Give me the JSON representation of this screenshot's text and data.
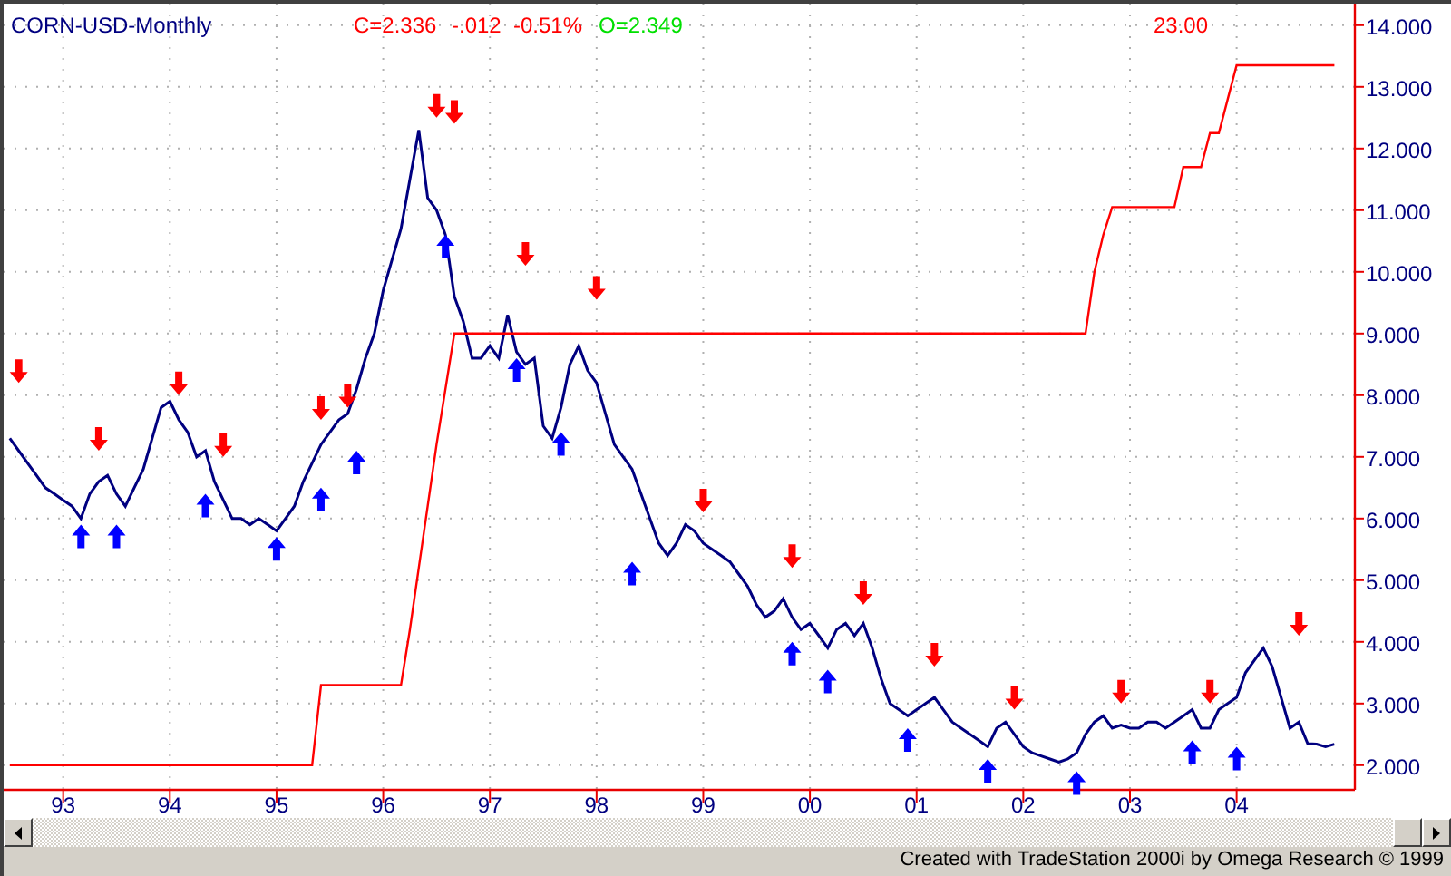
{
  "chart": {
    "title": "CORN-USD-Monthly",
    "quote": {
      "close": "C=2.336",
      "change": "-.012",
      "percent": "-0.51%",
      "open": "O=2.349"
    },
    "indicator_value": "23.00",
    "chart_data": {
      "type": "line",
      "categories": [
        null,
        null,
        null,
        null,
        null,
        null,
        "93",
        null,
        null,
        null,
        null,
        null,
        null,
        null,
        null,
        null,
        null,
        null,
        "94",
        null,
        null,
        null,
        null,
        null,
        null,
        null,
        null,
        null,
        null,
        null,
        "95",
        null,
        null,
        null,
        null,
        null,
        null,
        null,
        null,
        null,
        null,
        null,
        "96",
        null,
        null,
        null,
        null,
        null,
        null,
        null,
        null,
        null,
        null,
        null,
        "97",
        null,
        null,
        null,
        null,
        null,
        null,
        null,
        null,
        null,
        null,
        null,
        "98",
        null,
        null,
        null,
        null,
        null,
        null,
        null,
        null,
        null,
        null,
        null,
        "99",
        null,
        null,
        null,
        null,
        null,
        null,
        null,
        null,
        null,
        null,
        null,
        "00",
        null,
        null,
        null,
        null,
        null,
        null,
        null,
        null,
        null,
        null,
        null,
        "01",
        null,
        null,
        null,
        null,
        null,
        null,
        null,
        null,
        null,
        null,
        null,
        "02",
        null,
        null,
        null,
        null,
        null,
        null,
        null,
        null,
        null,
        null,
        null,
        "03",
        null,
        null,
        null,
        null,
        null,
        null,
        null,
        null,
        null,
        null,
        null,
        "04",
        null,
        null,
        null,
        null,
        null,
        null,
        null,
        null,
        null,
        null,
        null
      ],
      "series": [
        {
          "color": "#000080",
          "values": [
            7.3,
            7.1,
            6.9,
            6.7,
            6.5,
            6.4,
            6.3,
            6.2,
            6.0,
            6.4,
            6.6,
            6.7,
            6.4,
            6.2,
            6.5,
            6.8,
            7.3,
            7.8,
            7.9,
            7.6,
            7.4,
            7.0,
            7.1,
            6.6,
            6.3,
            6.0,
            6.0,
            5.9,
            6.0,
            5.9,
            5.8,
            6.0,
            6.2,
            6.6,
            6.9,
            7.2,
            7.4,
            7.6,
            7.7,
            8.1,
            8.6,
            9.0,
            9.7,
            10.2,
            10.7,
            11.5,
            12.3,
            11.2,
            11.0,
            10.6,
            9.6,
            9.2,
            8.6,
            8.6,
            8.8,
            8.6,
            9.3,
            8.7,
            8.5,
            8.6,
            7.5,
            7.3,
            7.8,
            8.5,
            8.8,
            8.4,
            8.2,
            7.7,
            7.2,
            7.0,
            6.8,
            6.4,
            6.0,
            5.6,
            5.4,
            5.6,
            5.9,
            5.8,
            5.6,
            5.5,
            5.4,
            5.3,
            5.1,
            4.9,
            4.6,
            4.4,
            4.5,
            4.7,
            4.4,
            4.2,
            4.3,
            4.1,
            3.9,
            4.2,
            4.3,
            4.1,
            4.3,
            3.9,
            3.4,
            3.0,
            2.9,
            2.8,
            2.9,
            3.0,
            3.1,
            2.9,
            2.7,
            2.6,
            2.5,
            2.4,
            2.3,
            2.6,
            2.7,
            2.5,
            2.3,
            2.2,
            2.15,
            2.1,
            2.05,
            2.1,
            2.2,
            2.5,
            2.7,
            2.8,
            2.6,
            2.65,
            2.6,
            2.6,
            2.7,
            2.7,
            2.6,
            2.7,
            2.8,
            2.9,
            2.6,
            2.6,
            2.9,
            3.0,
            3.1,
            3.5,
            3.7,
            3.9,
            3.6,
            3.1,
            2.6,
            2.7,
            2.35,
            2.34,
            2.3,
            2.34
          ]
        },
        {
          "color": "#ff0000",
          "values": [
            2.0,
            2.0,
            2.0,
            2.0,
            2.0,
            2.0,
            2.0,
            2.0,
            2.0,
            2.0,
            2.0,
            2.0,
            2.0,
            2.0,
            2.0,
            2.0,
            2.0,
            2.0,
            2.0,
            2.0,
            2.0,
            2.0,
            2.0,
            2.0,
            2.0,
            2.0,
            2.0,
            2.0,
            2.0,
            2.0,
            2.0,
            2.0,
            2.0,
            2.0,
            2.0,
            3.3,
            3.3,
            3.3,
            3.3,
            3.3,
            3.3,
            3.3,
            3.3,
            3.3,
            3.3,
            4.2,
            5.2,
            6.2,
            7.2,
            8.1,
            9.0,
            9.0,
            9.0,
            9.0,
            9.0,
            9.0,
            9.0,
            9.0,
            9.0,
            9.0,
            9.0,
            9.0,
            9.0,
            9.0,
            9.0,
            9.0,
            9.0,
            9.0,
            9.0,
            9.0,
            9.0,
            9.0,
            9.0,
            9.0,
            9.0,
            9.0,
            9.0,
            9.0,
            9.0,
            9.0,
            9.0,
            9.0,
            9.0,
            9.0,
            9.0,
            9.0,
            9.0,
            9.0,
            9.0,
            9.0,
            9.0,
            9.0,
            9.0,
            9.0,
            9.0,
            9.0,
            9.0,
            9.0,
            9.0,
            9.0,
            9.0,
            9.0,
            9.0,
            9.0,
            9.0,
            9.0,
            9.0,
            9.0,
            9.0,
            9.0,
            9.0,
            9.0,
            9.0,
            9.0,
            9.0,
            9.0,
            9.0,
            9.0,
            9.0,
            9.0,
            9.0,
            9.0,
            10.0,
            10.6,
            11.05,
            11.05,
            11.05,
            11.05,
            11.05,
            11.05,
            11.05,
            11.05,
            11.7,
            11.7,
            11.7,
            12.25,
            12.25,
            12.8,
            13.35,
            13.35,
            13.35,
            13.35,
            13.35,
            13.35,
            13.35,
            13.35,
            13.35,
            13.35,
            13.35,
            13.35
          ]
        }
      ],
      "ylim": [
        1.6,
        14.35
      ],
      "yticks": [
        {
          "value": 2,
          "label": "2.000"
        },
        {
          "value": 3,
          "label": "3.000"
        },
        {
          "value": 4,
          "label": "4.000"
        },
        {
          "value": 5,
          "label": "5.000"
        },
        {
          "value": 6,
          "label": "6.000"
        },
        {
          "value": 7,
          "label": "7.000"
        },
        {
          "value": 8,
          "label": "8.000"
        },
        {
          "value": 9,
          "label": "9.000"
        },
        {
          "value": 10,
          "label": "10.000"
        },
        {
          "value": 11,
          "label": "11.000"
        },
        {
          "value": 12,
          "label": "12.000"
        },
        {
          "value": 13,
          "label": "13.000"
        },
        {
          "value": 14,
          "label": "14.000"
        }
      ],
      "grid": true
    }
  },
  "status_bar": {
    "text": "Created with TradeStation 2000i by Omega Research © 1999"
  }
}
